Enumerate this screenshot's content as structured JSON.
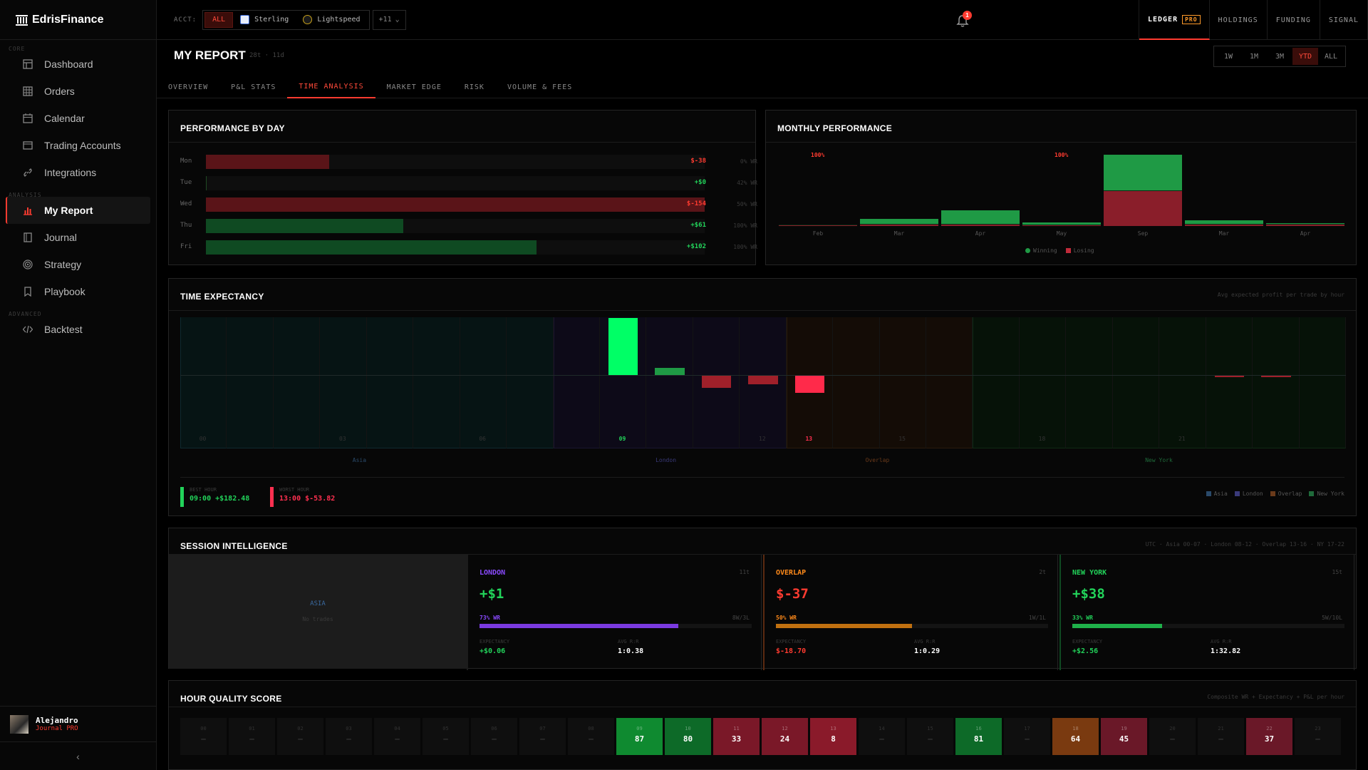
{
  "brand": {
    "name": "EdrisFinance"
  },
  "sidebar": {
    "sections": [
      {
        "label": "CORE",
        "items": [
          {
            "label": "Dashboard",
            "icon": "dashboard-icon"
          },
          {
            "label": "Orders",
            "icon": "orders-icon"
          },
          {
            "label": "Calendar",
            "icon": "calendar-icon"
          },
          {
            "label": "Trading Accounts",
            "icon": "accounts-icon"
          },
          {
            "label": "Integrations",
            "icon": "link-icon"
          }
        ]
      },
      {
        "label": "ANALYSIS",
        "items": [
          {
            "label": "My Report",
            "icon": "bar-chart-icon",
            "active": true
          },
          {
            "label": "Journal",
            "icon": "journal-icon"
          },
          {
            "label": "Strategy",
            "icon": "target-icon"
          },
          {
            "label": "Playbook",
            "icon": "bookmark-icon"
          }
        ]
      },
      {
        "label": "ADVANCED",
        "items": [
          {
            "label": "Backtest",
            "icon": "code-icon"
          }
        ]
      }
    ],
    "user": {
      "name": "Alejandro",
      "plan": "Journal PRO"
    },
    "collapse": "‹"
  },
  "topbar": {
    "acct_label": "ACCT:",
    "accounts": [
      {
        "label": "ALL",
        "selected": true
      },
      {
        "label": "Sterling",
        "icon": "sterling-icon"
      },
      {
        "label": "Lightspeed",
        "icon": "lightspeed-icon"
      }
    ],
    "more": "+11",
    "notifications": "1",
    "nav": [
      {
        "label": "LEDGER",
        "badge": "PRO",
        "active": true
      },
      {
        "label": "HOLDINGS"
      },
      {
        "label": "FUNDING"
      },
      {
        "label": "SIGNAL"
      }
    ]
  },
  "page": {
    "title": "MY REPORT",
    "meta": "28t · 11d",
    "ranges": [
      "1W",
      "1M",
      "3M",
      "YTD",
      "ALL"
    ],
    "range_selected": "YTD",
    "tabs": [
      "OVERVIEW",
      "P&L STATS",
      "TIME ANALYSIS",
      "MARKET EDGE",
      "RISK",
      "VOLUME & FEES"
    ],
    "tab_active": "TIME ANALYSIS"
  },
  "perf_by_day": {
    "title": "PERFORMANCE BY DAY",
    "rows": [
      {
        "day": "Mon",
        "value": -38,
        "label": "$-38",
        "wr": "0% WR"
      },
      {
        "day": "Tue",
        "value": 0,
        "label": "+$0",
        "wr": "42% WR"
      },
      {
        "day": "Wed",
        "value": -154,
        "label": "$-154",
        "wr": "50% WR"
      },
      {
        "day": "Thu",
        "value": 61,
        "label": "+$61",
        "wr": "100% WR"
      },
      {
        "day": "Fri",
        "value": 102,
        "label": "+$102",
        "wr": "100% WR"
      }
    ]
  },
  "monthly": {
    "title": "MONTHLY PERFORMANCE",
    "legend": [
      "Winning",
      "Losing"
    ],
    "months": [
      {
        "label": "Feb",
        "win": 1,
        "loss": 1,
        "top": "100%"
      },
      {
        "label": "Mar",
        "win": 8,
        "loss": 2
      },
      {
        "label": "Apr",
        "win": 20,
        "loss": 2
      },
      {
        "label": "May",
        "win": 4,
        "loss": 1,
        "top": "100%"
      },
      {
        "label": "Sep",
        "win": 50,
        "loss": 48
      },
      {
        "label": "Mar",
        "win": 6,
        "loss": 2
      },
      {
        "label": "Apr",
        "win": 2,
        "loss": 2
      }
    ],
    "colors": {
      "win": "#1f9a45",
      "loss": "#8a1e2a"
    }
  },
  "time_expectancy": {
    "title": "TIME EXPECTANCY",
    "subtitle": "Avg expected profit per trade by hour",
    "hours": [
      0,
      0,
      0,
      0,
      0,
      0,
      0,
      0,
      0,
      182.48,
      22,
      -38,
      -28,
      -53.82,
      0,
      0,
      0,
      0,
      0,
      0,
      0,
      0,
      -5,
      -5.5,
      0
    ],
    "ticks": [
      "00",
      "03",
      "06",
      "09",
      "12",
      "13",
      "15",
      "18",
      "21"
    ],
    "sessions": [
      {
        "name": "Asia",
        "color": "#2a4a6a"
      },
      {
        "name": "London",
        "color": "#3a3a7a"
      },
      {
        "name": "Overlap",
        "color": "#6a3a1a"
      },
      {
        "name": "New York",
        "color": "#1f6a3a"
      }
    ],
    "best": {
      "label": "BEST HOUR",
      "value": "09:00 +$182.48"
    },
    "worst": {
      "label": "WORST HOUR",
      "value": "13:00 $-53.82"
    },
    "legend": [
      "Asia",
      "London",
      "Overlap",
      "New York"
    ]
  },
  "session_intel": {
    "title": "SESSION INTELLIGENCE",
    "subtitle": "UTC · Asia 00-07 · London 08-12 · Overlap 13-16 · NY 17-22",
    "asia": {
      "name": "ASIA",
      "note": "No trades"
    },
    "cards": [
      {
        "name": "LONDON",
        "count": "11t",
        "pnl": "+$1",
        "wr": "73% WR",
        "wr_pct": 73,
        "wl": "8W/3L",
        "exp_label": "EXPECTANCY",
        "exp": "+$0.06",
        "rr_label": "AVG R:R",
        "rr": "1:0.38",
        "color": "#8a4aff"
      },
      {
        "name": "OVERLAP",
        "count": "2t",
        "pnl": "$-37",
        "wr": "50% WR",
        "wr_pct": 50,
        "wl": "1W/1L",
        "exp_label": "EXPECTANCY",
        "exp": "$-18.70",
        "rr_label": "AVG R:R",
        "rr": "1:0.29",
        "color": "#ff8a1a"
      },
      {
        "name": "NEW YORK",
        "count": "15t",
        "pnl": "+$38",
        "wr": "33% WR",
        "wr_pct": 33,
        "wl": "5W/10L",
        "exp_label": "EXPECTANCY",
        "exp": "+$2.56",
        "rr_label": "AVG R:R",
        "rr": "1:32.82",
        "color": "#22d35a"
      }
    ]
  },
  "hour_quality": {
    "title": "HOUR QUALITY SCORE",
    "subtitle": "Composite WR + Expectancy + P&L per hour",
    "cells": [
      {
        "h": "00",
        "s": "—"
      },
      {
        "h": "01",
        "s": "—"
      },
      {
        "h": "02",
        "s": "—"
      },
      {
        "h": "03",
        "s": "—"
      },
      {
        "h": "04",
        "s": "—"
      },
      {
        "h": "05",
        "s": "—"
      },
      {
        "h": "06",
        "s": "—"
      },
      {
        "h": "07",
        "s": "—"
      },
      {
        "h": "08",
        "s": "—"
      },
      {
        "h": "09",
        "s": "87",
        "c": "#0f8a30"
      },
      {
        "h": "10",
        "s": "80",
        "c": "#0d6a28"
      },
      {
        "h": "11",
        "s": "33",
        "c": "#7a1828"
      },
      {
        "h": "12",
        "s": "24",
        "c": "#7a1828"
      },
      {
        "h": "13",
        "s": "8",
        "c": "#8a1a2a"
      },
      {
        "h": "14",
        "s": "—"
      },
      {
        "h": "15",
        "s": "—"
      },
      {
        "h": "16",
        "s": "81",
        "c": "#0d6a28"
      },
      {
        "h": "17",
        "s": "—"
      },
      {
        "h": "18",
        "s": "64",
        "c": "#7a3a10"
      },
      {
        "h": "19",
        "s": "45",
        "c": "#6a1828"
      },
      {
        "h": "20",
        "s": "—"
      },
      {
        "h": "21",
        "s": "—"
      },
      {
        "h": "22",
        "s": "37",
        "c": "#6a1828"
      },
      {
        "h": "23",
        "s": "—"
      }
    ]
  }
}
